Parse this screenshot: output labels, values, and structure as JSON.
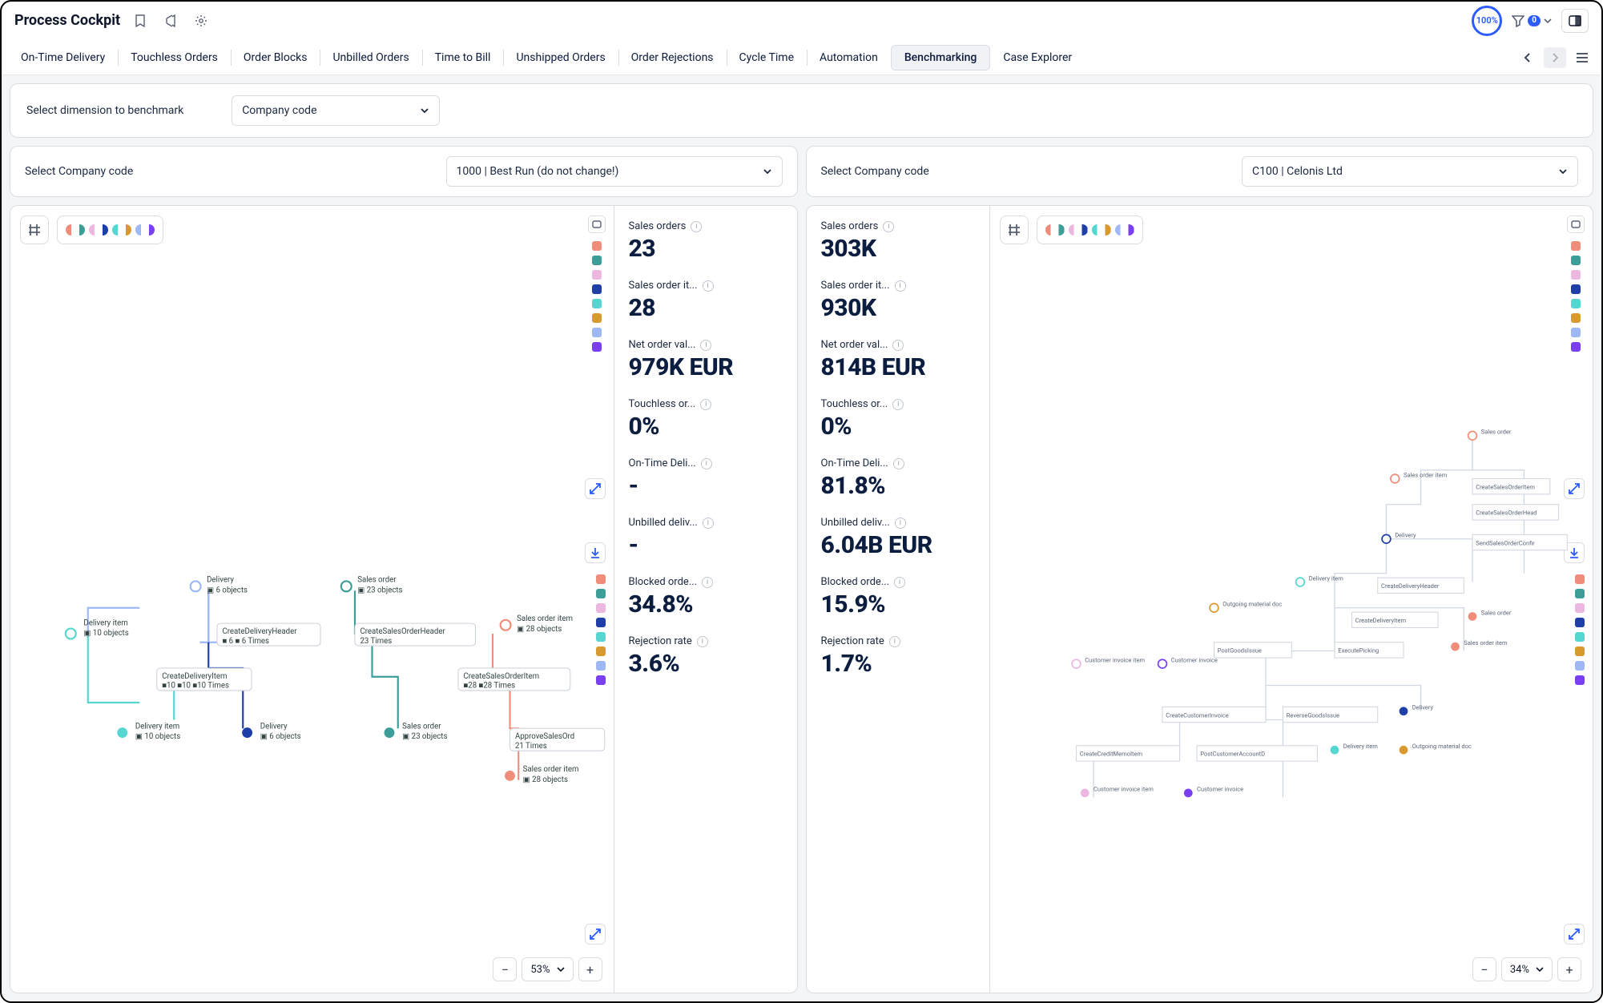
{
  "header": {
    "title": "Process Cockpit",
    "percent_badge": "100%",
    "filter_count": "0"
  },
  "tabs": {
    "items": [
      "On-Time Delivery",
      "Touchless Orders",
      "Order Blocks",
      "Unbilled Orders",
      "Time to Bill",
      "Unshipped Orders",
      "Order Rejections",
      "Cycle Time",
      "Automation",
      "Benchmarking",
      "Case Explorer"
    ],
    "active_index": 9
  },
  "benchmark": {
    "label": "Select dimension to benchmark",
    "value": "Company code"
  },
  "left": {
    "select_label": "Select Company code",
    "select_value": "1000 | Best Run (do not change!)",
    "zoom": "53%",
    "metrics": [
      {
        "label": "Sales orders",
        "value": "23"
      },
      {
        "label": "Sales order it...",
        "value": "28"
      },
      {
        "label": "Net order val...",
        "value": "979K EUR"
      },
      {
        "label": "Touchless or...",
        "value": "0%"
      },
      {
        "label": "On-Time Deli...",
        "value": "-"
      },
      {
        "label": "Unbilled deliv...",
        "value": "-"
      },
      {
        "label": "Blocked orde...",
        "value": "34.8%"
      },
      {
        "label": "Rejection rate",
        "value": "3.6%"
      }
    ]
  },
  "right": {
    "select_label": "Select Company code",
    "select_value": "C100 | Celonis Ltd",
    "zoom": "34%",
    "metrics": [
      {
        "label": "Sales orders",
        "value": "303K"
      },
      {
        "label": "Sales order it...",
        "value": "930K"
      },
      {
        "label": "Net order val...",
        "value": "814B EUR"
      },
      {
        "label": "Touchless or...",
        "value": "0%"
      },
      {
        "label": "On-Time Deli...",
        "value": "81.8%"
      },
      {
        "label": "Unbilled deliv...",
        "value": "6.04B EUR"
      },
      {
        "label": "Blocked orde...",
        "value": "15.9%"
      },
      {
        "label": "Rejection rate",
        "value": "1.7%"
      }
    ]
  },
  "palette": [
    "#f08d7a",
    "#3c9d99",
    "#ecb7e1",
    "#1e3fa8",
    "#55d6d0",
    "#d89a2e",
    "#9db8f4",
    "#7a3ff0"
  ],
  "process_left": {
    "nodes": [
      {
        "label": "Delivery item",
        "sub": "10 objects"
      },
      {
        "label": "Delivery",
        "sub": "6 objects"
      },
      {
        "label": "CreateDeliveryHeader",
        "sub": "6 Times"
      },
      {
        "label": "CreateDeliveryItem",
        "sub": "10 Times"
      },
      {
        "label": "Delivery item",
        "sub": "10 objects"
      },
      {
        "label": "Delivery",
        "sub": "6 objects"
      },
      {
        "label": "Sales order",
        "sub": "23 objects"
      },
      {
        "label": "CreateSalesOrderHeader",
        "sub": "23 Times"
      },
      {
        "label": "CreateSalesOrderItem",
        "sub": "28 Times"
      },
      {
        "label": "Sales order",
        "sub": "23 objects"
      },
      {
        "label": "Sales order item",
        "sub": "28 objects"
      },
      {
        "label": "ApproveSalesOrd",
        "sub": "21 Times"
      },
      {
        "label": "Sales order item",
        "sub": "28 objects"
      }
    ]
  },
  "process_right": {
    "nodes": [
      {
        "label": "Sales order"
      },
      {
        "label": "Sales order item"
      },
      {
        "label": "CreateSalesOrderItem"
      },
      {
        "label": "CreateSalesOrderHeader"
      },
      {
        "label": "Delivery"
      },
      {
        "label": "SendSalesOrderConfirmation"
      },
      {
        "label": "Delivery item"
      },
      {
        "label": "CreateDeliveryHeader"
      },
      {
        "label": "Outgoing material document item"
      },
      {
        "label": "CreateDeliveryItem"
      },
      {
        "label": "Sales order"
      },
      {
        "label": "PostGoodsIssue"
      },
      {
        "label": "ExecutePicking"
      },
      {
        "label": "Sales order item"
      },
      {
        "label": "Customer invoice item"
      },
      {
        "label": "Customer invoice"
      },
      {
        "label": "CreateCustomerInvoice"
      },
      {
        "label": "ReverseGoodsIssue"
      },
      {
        "label": "Delivery"
      },
      {
        "label": "CreateCreditMemoItem"
      },
      {
        "label": "PostCustomerAccountDebit"
      },
      {
        "label": "Delivery item"
      },
      {
        "label": "Outgoing material document item"
      },
      {
        "label": "Customer invoice item"
      },
      {
        "label": "Customer invoice"
      }
    ]
  }
}
